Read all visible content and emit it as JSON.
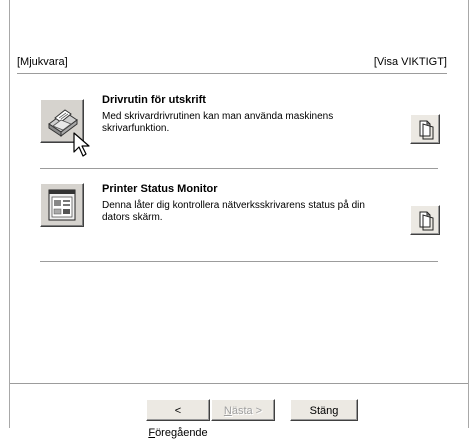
{
  "header": {
    "left_label": "[Mjukvara]",
    "right_label": "[Visa VIKTIGT]"
  },
  "items": [
    {
      "title": "Drivrutin för utskrift",
      "description": "Med skrivardrivrutinen kan man använda maskinens skrivarfunktion.",
      "icon": "printer-driver-icon",
      "doc_icon": "document-icon"
    },
    {
      "title": "Printer Status Monitor",
      "description": "Denna låter dig kontrollera nätverksskrivarens status på din dators skärm.",
      "icon": "status-monitor-icon",
      "doc_icon": "document-icon"
    }
  ],
  "footer": {
    "back_prefix": "< ",
    "back_underline": "F",
    "back_rest": "öregående",
    "next_underline": "N",
    "next_rest": "ästa >",
    "close_label": "Stäng"
  },
  "cursor": "arrow-cursor-icon"
}
